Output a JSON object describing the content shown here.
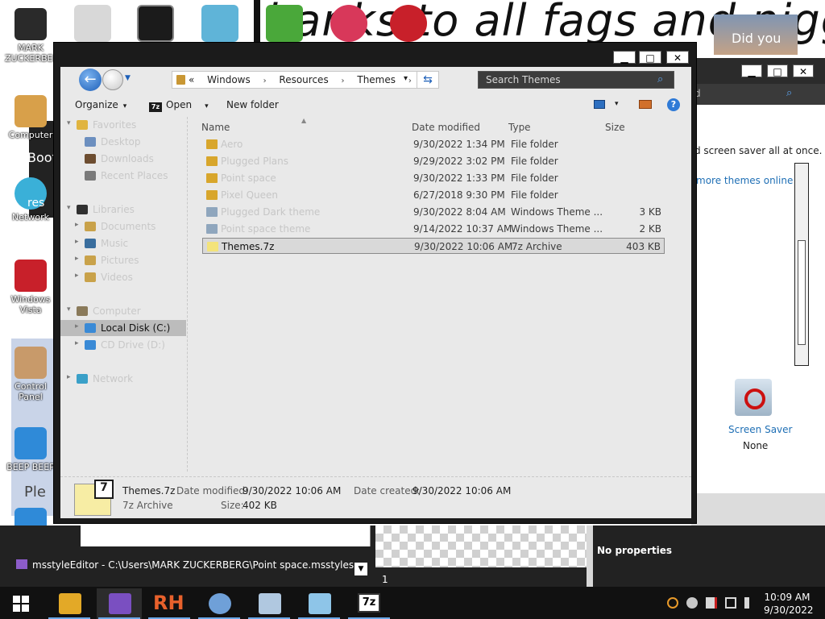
{
  "desktop": {
    "banner_text": "hanks to all fags and niggers",
    "photo_caption": "Did you",
    "icons": [
      {
        "label": "MARK ZUCKERBERG"
      },
      {
        "label": "Computer"
      },
      {
        "label": "Network"
      },
      {
        "label": "Windows Vista"
      },
      {
        "label": "Control Panel"
      },
      {
        "label": "BEEP BEEP"
      }
    ],
    "partial_texts": [
      "Boot",
      "res",
      "Ple"
    ]
  },
  "explorer": {
    "window_buttons": {
      "minimize": "▁",
      "maximize": "□",
      "close": "✕"
    },
    "nav": {
      "back": "←",
      "history": "▼"
    },
    "address": {
      "overflow": "«",
      "crumbs": [
        "Windows",
        "Resources",
        "Themes"
      ],
      "separator": "›",
      "dropdown": "▾",
      "refresh": "⇆"
    },
    "search": {
      "placeholder": "Search Themes",
      "icon": "search-icon"
    },
    "toolbar": {
      "organize": "Organize",
      "open": "Open",
      "open_icon_text": "7z",
      "new_folder": "New folder",
      "caret": "▾",
      "help": "?"
    },
    "columns": {
      "name": "Name",
      "date": "Date modified",
      "type": "Type",
      "size": "Size",
      "sort_indicator": "▲"
    },
    "nav_pane": [
      {
        "label": "Favorites",
        "icon_color": "#e0b440",
        "arrow": "▾",
        "indent": 0
      },
      {
        "label": "Desktop",
        "icon_color": "#6c8fbf",
        "arrow": "",
        "indent": 1
      },
      {
        "label": "Downloads",
        "icon_color": "#6d4d30",
        "arrow": "",
        "indent": 1
      },
      {
        "label": "Recent Places",
        "icon_color": "#7a7a7a",
        "arrow": "",
        "indent": 1
      },
      {
        "label": "Libraries",
        "icon_color": "#303030",
        "arrow": "▾",
        "indent": 0
      },
      {
        "label": "Documents",
        "icon_color": "#c9a24a",
        "arrow": "▸",
        "indent": 1
      },
      {
        "label": "Music",
        "icon_color": "#3a6e9e",
        "arrow": "▸",
        "indent": 1
      },
      {
        "label": "Pictures",
        "icon_color": "#c9a24a",
        "arrow": "▸",
        "indent": 1
      },
      {
        "label": "Videos",
        "icon_color": "#c9a24a",
        "arrow": "▸",
        "indent": 1
      },
      {
        "label": "Computer",
        "icon_color": "#8a7a5a",
        "arrow": "▾",
        "indent": 0
      },
      {
        "label": "Local Disk (C:)",
        "icon_color": "#3a8ad6",
        "arrow": "▸",
        "indent": 1,
        "selected": true
      },
      {
        "label": "CD Drive (D:)",
        "icon_color": "#3a8ad6",
        "arrow": "▸",
        "indent": 1
      },
      {
        "label": "Network",
        "icon_color": "#3aa0c8",
        "arrow": "▸",
        "indent": 0
      }
    ],
    "files": [
      {
        "name": "Aero",
        "date": "9/30/2022 1:34 PM",
        "type": "File folder",
        "size": "",
        "icon_color": "#d8a62c"
      },
      {
        "name": "Plugged Plans",
        "date": "9/29/2022 3:02 PM",
        "type": "File folder",
        "size": "",
        "icon_color": "#d8a62c"
      },
      {
        "name": "Point space",
        "date": "9/30/2022 1:33 PM",
        "type": "File folder",
        "size": "",
        "icon_color": "#d8a62c"
      },
      {
        "name": "Pixel Queen",
        "date": "6/27/2018 9:30 PM",
        "type": "File folder",
        "size": "",
        "icon_color": "#d8a62c"
      },
      {
        "name": "Plugged Dark theme",
        "date": "9/30/2022 8:04 AM",
        "type": "Windows Theme ...",
        "size": "3 KB",
        "icon_color": "#8fa6bd"
      },
      {
        "name": "Point space theme",
        "date": "9/14/2022 10:37 AM",
        "type": "Windows Theme ...",
        "size": "2 KB",
        "icon_color": "#8fa6bd"
      },
      {
        "name": "Themes.7z",
        "date": "9/30/2022 10:06 AM",
        "type": "7z Archive",
        "size": "403 KB",
        "icon_color": "#f3e37a",
        "selected": true
      }
    ],
    "details": {
      "name": "Themes.7z",
      "type": "7z Archive",
      "date_modified_label": "Date modified:",
      "date_modified": "9/30/2022 10:06 AM",
      "date_created_label": "Date created:",
      "date_created": "9/30/2022 10:06 AM",
      "size_label": "Size:",
      "size": "402 KB"
    }
  },
  "back_window": {
    "search_placeholder_fragment": "d",
    "description": "d screen saver all at once.",
    "link": "more themes online",
    "screensaver_label": "Screen Saver",
    "screensaver_value": "None"
  },
  "editor": {
    "title": "msstyleEditor - C:\\Users\\MARK ZUCKERBERG\\Point space.msstyles",
    "no_properties": "No properties",
    "page_number": "1",
    "toggle": "▼"
  },
  "taskbar": {
    "apps": [
      {
        "name": "file-explorer",
        "color": "#e3a927",
        "running": true
      },
      {
        "name": "msstyle-editor",
        "color": "#7a4fc1",
        "running": true,
        "active": true
      },
      {
        "name": "resource-hacker",
        "text": "RH",
        "running": true
      },
      {
        "name": "paint",
        "color": "#6fa0d8",
        "running": true
      },
      {
        "name": "theme-app",
        "color": "#b0c8e0",
        "running": true
      },
      {
        "name": "notepad",
        "color": "#8ec5e8",
        "running": true
      },
      {
        "name": "7zip",
        "text": "7z",
        "running": true
      }
    ],
    "clock_time": "10:09 AM",
    "clock_date": "9/30/2022"
  }
}
